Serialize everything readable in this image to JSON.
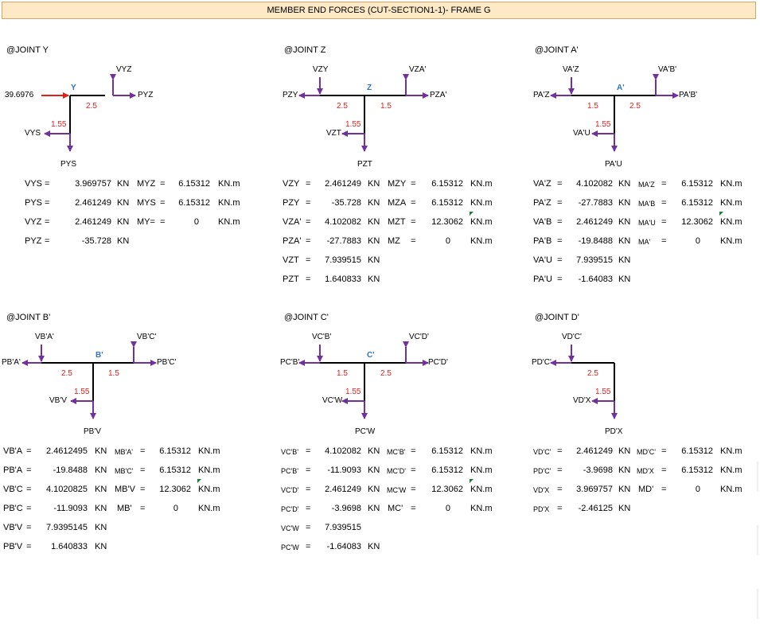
{
  "title": "MEMBER END FORCES (CUT-SECTION1-1)- FRAME G",
  "joints": {
    "y": {
      "heading": "@JOINT  Y",
      "labels": {
        "center": "Y",
        "vl": "",
        "vr": "VYZ",
        "hl": "",
        "hr": "PYZ",
        "down": "PYS",
        "left_down": "VYS",
        "dist_l": "",
        "dist_r": "2.5",
        "dist_d": "1.55",
        "load": "39.6976"
      },
      "rows": [
        {
          "l1": "VYS",
          "v1": "3.969757",
          "u1": "KN",
          "l2": "MYZ",
          "v2": "6.15312",
          "u2": "KN.m"
        },
        {
          "l1": "PYS",
          "v1": "2.461249",
          "u1": "KN",
          "l2": "MYS",
          "v2": "6.15312",
          "u2": "KN.m"
        },
        {
          "l1": "VYZ",
          "v1": "2.461249",
          "u1": "KN",
          "l2": "MY=",
          "v2": "0",
          "u2": "KN.m"
        },
        {
          "l1": "PYZ",
          "v1": "-35.728",
          "u1": "KN",
          "l2": "",
          "v2": "",
          "u2": ""
        }
      ]
    },
    "z": {
      "heading": "@JOINT  Z",
      "labels": {
        "center": "Z",
        "vl": "VZY",
        "vr": "VZA'",
        "hl": "PZY",
        "hr": "PZA'",
        "down": "PZT",
        "left_down": "VZT",
        "dist_l": "2.5",
        "dist_r": "1.5",
        "dist_d": "1.55",
        "load": ""
      },
      "rows": [
        {
          "l1": "VZY",
          "v1": "2.461249",
          "u1": "KN",
          "l2": "MZY",
          "v2": "6.15312",
          "u2": "KN.m"
        },
        {
          "l1": "PZY",
          "v1": "-35.728",
          "u1": "KN",
          "l2": "MZA",
          "v2": "6.15312",
          "u2": "KN.m"
        },
        {
          "l1": "VZA'",
          "v1": "4.102082",
          "u1": "KN",
          "l2": "MZT",
          "v2": "12.3062",
          "u2": "KN.m"
        },
        {
          "l1": "PZA'",
          "v1": "-27.7883",
          "u1": "KN",
          "l2": "MZ",
          "v2": "0",
          "u2": "KN.m"
        },
        {
          "l1": "VZT",
          "v1": "7.939515",
          "u1": "KN",
          "l2": "",
          "v2": "",
          "u2": ""
        },
        {
          "l1": "PZT",
          "v1": "1.640833",
          "u1": "KN",
          "l2": "",
          "v2": "",
          "u2": ""
        }
      ]
    },
    "a": {
      "heading": "@JOINT  A'",
      "labels": {
        "center": "A'",
        "vl": "VA'Z",
        "vr": "VA'B'",
        "hl": "PA'Z",
        "hr": "PA'B'",
        "down": "PA'U",
        "left_down": "VA'U",
        "dist_l": "1.5",
        "dist_r": "2.5",
        "dist_d": "1.55",
        "load": ""
      },
      "rows": [
        {
          "l1": "VA'Z",
          "v1": "4.102082",
          "u1": "KN",
          "l2": "MA'Z",
          "v2": "6.15312",
          "u2": "KN.m"
        },
        {
          "l1": "PA'Z",
          "v1": "-27.7883",
          "u1": "KN",
          "l2": "MA'B",
          "v2": "6.15312",
          "u2": "KN.m"
        },
        {
          "l1": "VA'B",
          "v1": "2.461249",
          "u1": "KN",
          "l2": "MA'U",
          "v2": "12.3062",
          "u2": "KN.m"
        },
        {
          "l1": "PA'B",
          "v1": "-19.8488",
          "u1": "KN",
          "l2": "MA'",
          "v2": "0",
          "u2": "KN.m"
        },
        {
          "l1": "VA'U",
          "v1": "7.939515",
          "u1": "KN",
          "l2": "",
          "v2": "",
          "u2": ""
        },
        {
          "l1": "PA'U",
          "v1": "-1.64083",
          "u1": "KN",
          "l2": "",
          "v2": "",
          "u2": ""
        }
      ]
    },
    "b": {
      "heading": "@JOINT  B'",
      "labels": {
        "center": "B'",
        "vl": "VB'A'",
        "vr": "VB'C'",
        "hl": "PB'A'",
        "hr": "PB'C'",
        "down": "PB'V",
        "left_down": "VB'V",
        "dist_l": "2.5",
        "dist_r": "1.5",
        "dist_d": "1.55",
        "load": ""
      },
      "rows": [
        {
          "l1": "VB'A",
          "v1": "2.4612495",
          "u1": "KN",
          "l2": "MB'A'",
          "v2": "6.15312",
          "u2": "KN.m"
        },
        {
          "l1": "PB'A",
          "v1": "-19.8488",
          "u1": "KN",
          "l2": "MB'C'",
          "v2": "6.15312",
          "u2": "KN.m"
        },
        {
          "l1": "VB'C",
          "v1": "4.1020825",
          "u1": "KN",
          "l2": "MB'V",
          "v2": "12.3062",
          "u2": "KN.m"
        },
        {
          "l1": "PB'C",
          "v1": "-11.9093",
          "u1": "KN",
          "l2": "MB'",
          "v2": "0",
          "u2": "KN.m"
        },
        {
          "l1": "VB'V",
          "v1": "7.9395145",
          "u1": "KN",
          "l2": "",
          "v2": "",
          "u2": ""
        },
        {
          "l1": "PB'V",
          "v1": "1.640833",
          "u1": "KN",
          "l2": "",
          "v2": "",
          "u2": ""
        }
      ]
    },
    "c": {
      "heading": "@JOINT  C'",
      "labels": {
        "center": "C'",
        "vl": "VC'B'",
        "vr": "VC'D'",
        "hl": "PC'B'",
        "hr": "PC'D'",
        "down": "PC'W",
        "left_down": "VC'W",
        "dist_l": "1.5",
        "dist_r": "2.5",
        "dist_d": "1.55",
        "load": ""
      },
      "rows": [
        {
          "l1": "VC'B'",
          "v1": "4.102082",
          "u1": "KN",
          "l2": "MC'B'",
          "v2": "6.15312",
          "u2": "KN.m"
        },
        {
          "l1": "PC'B'",
          "v1": "-11.9093",
          "u1": "KN",
          "l2": "MC'D'",
          "v2": "6.15312",
          "u2": "KN.m"
        },
        {
          "l1": "VC'D'",
          "v1": "2.461249",
          "u1": "KN",
          "l2": "MC'W",
          "v2": "12.3062",
          "u2": "KN.m"
        },
        {
          "l1": "PC'D'",
          "v1": "-3.9698",
          "u1": "KN",
          "l2": "MC'",
          "v2": "0",
          "u2": "KN.m"
        },
        {
          "l1": "VC'W",
          "v1": "7.939515",
          "u1": "KN",
          "l2": "",
          "v2": "",
          "u2": ""
        },
        {
          "l1": "PC'W",
          "v1": "-1.64083",
          "u1": "KN",
          "l2": "",
          "v2": "",
          "u2": ""
        }
      ]
    },
    "d": {
      "heading": "@JOINT  D'",
      "labels": {
        "center": "",
        "vl": "VD'C'",
        "vr": "",
        "hl": "PD'C'",
        "hr": "",
        "down": "PD'X",
        "left_down": "VD'X",
        "dist_l": "2.5",
        "dist_r": "",
        "dist_d": "1.55",
        "load": ""
      },
      "rows": [
        {
          "l1": "VD'C'",
          "v1": "2.461249",
          "u1": "KN",
          "l2": "MD'C'",
          "v2": "6.15312",
          "u2": "KN.m"
        },
        {
          "l1": "PD'C'",
          "v1": "-3.9698",
          "u1": "KN",
          "l2": "MD'X",
          "v2": "6.15312",
          "u2": "KN.m"
        },
        {
          "l1": "VD'X",
          "v1": "3.969757",
          "u1": "KN",
          "l2": "MD'",
          "v2": "0",
          "u2": "KN.m"
        },
        {
          "l1": "PD'X",
          "v1": "-2.46125",
          "u1": "KN",
          "l2": "",
          "v2": "",
          "u2": ""
        }
      ]
    }
  },
  "colors": {
    "frame": "#000000",
    "force_arrow": "#7030a0",
    "load_arrow": "#e0201b",
    "dimension": "#e0201b",
    "joint_label": "#2e74c2",
    "header_fill": "#fde9c5",
    "comment_marker": "#1a7f2e"
  }
}
